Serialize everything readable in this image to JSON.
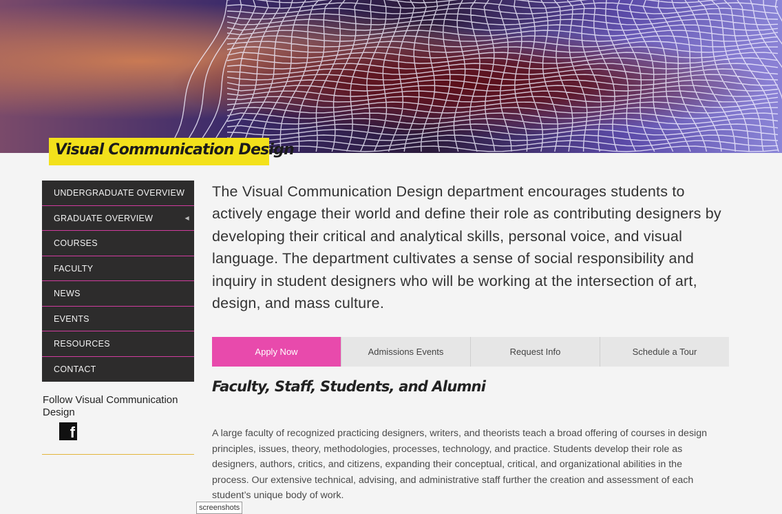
{
  "header": {
    "department_title": "Visual Communication Design"
  },
  "sidebar": {
    "items": [
      {
        "label": "UNDERGRADUATE OVERVIEW"
      },
      {
        "label": "GRADUATE OVERVIEW",
        "has_submenu": true
      },
      {
        "label": "COURSES"
      },
      {
        "label": "FACULTY"
      },
      {
        "label": "NEWS"
      },
      {
        "label": "EVENTS"
      },
      {
        "label": "RESOURCES"
      },
      {
        "label": "CONTACT"
      }
    ],
    "follow_text": "Follow Visual Communication Design",
    "social_icons": [
      "facebook-icon"
    ]
  },
  "main": {
    "intro": "The Visual Communication Design department encourages students to actively engage their world and define their role as contributing designers by developing their critical and analytical skills, personal voice, and visual language. The department cultivates a sense of social responsibility and inquiry in student designers who will be working at the intersection of art, design, and mass culture.",
    "cta_buttons": [
      {
        "label": "Apply Now"
      },
      {
        "label": "Admissions Events"
      },
      {
        "label": "Request Info"
      },
      {
        "label": "Schedule a Tour"
      }
    ],
    "section_heading": "Faculty, Staff, Students, and Alumni",
    "section_body": "A large faculty of recognized practicing designers, writers, and theorists teach a broad offering of courses in design principles, issues, theory, methodologies, processes, technology, and practice. Students develop their role as designers, authors, critics, and citizens, expanding their conceptual, critical, and organizational abilities in the process. Our extensive technical, advising, and administrative staff further the creation and assessment of each student’s unique body of work."
  },
  "tooltip": "screenshots",
  "colors": {
    "title_highlight": "#f3e11b",
    "nav_background": "#2d2c2c",
    "nav_divider": "#d13c9f",
    "apply_button": "#e84aac",
    "rule": "#e3b53a"
  }
}
